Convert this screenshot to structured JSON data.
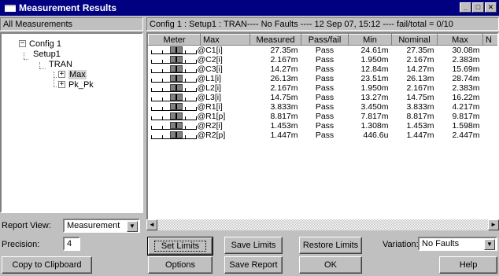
{
  "window": {
    "title": "Measurement Results",
    "controls": {
      "minimize": "_",
      "maximize": "□",
      "close": "✕"
    }
  },
  "left_header": "All Measurements",
  "right_header": "Config 1 : Setup1 : TRAN---- No Faults ----   12 Sep 07, 15:12 ---- fail/total = 0/10",
  "tree": {
    "config": "Config 1",
    "setup": "Setup1",
    "analysis": "TRAN",
    "children": [
      "Max",
      "Pk_Pk"
    ],
    "selected": "Max"
  },
  "table": {
    "columns": [
      "Meter",
      "Max",
      "Measured",
      "Pass/fail",
      "Min",
      "Nominal",
      "Max",
      "N"
    ],
    "rows": [
      {
        "name": "@C1[i]",
        "measured": "27.35m",
        "pass": "Pass",
        "min": "24.61m",
        "nominal": "27.35m",
        "max": "30.08m"
      },
      {
        "name": "@C2[i]",
        "measured": "2.167m",
        "pass": "Pass",
        "min": "1.950m",
        "nominal": "2.167m",
        "max": "2.383m"
      },
      {
        "name": "@C3[i]",
        "measured": "14.27m",
        "pass": "Pass",
        "min": "12.84m",
        "nominal": "14.27m",
        "max": "15.69m"
      },
      {
        "name": "@L1[i]",
        "measured": "26.13m",
        "pass": "Pass",
        "min": "23.51m",
        "nominal": "26.13m",
        "max": "28.74m"
      },
      {
        "name": "@L2[i]",
        "measured": "2.167m",
        "pass": "Pass",
        "min": "1.950m",
        "nominal": "2.167m",
        "max": "2.383m"
      },
      {
        "name": "@L3[i]",
        "measured": "14.75m",
        "pass": "Pass",
        "min": "13.27m",
        "nominal": "14.75m",
        "max": "16.22m"
      },
      {
        "name": "@R1[i]",
        "measured": "3.833m",
        "pass": "Pass",
        "min": "3.450m",
        "nominal": "3.833m",
        "max": "4.217m"
      },
      {
        "name": "@R1[p]",
        "measured": "8.817m",
        "pass": "Pass",
        "min": "7.817m",
        "nominal": "8.817m",
        "max": "9.817m"
      },
      {
        "name": "@R2[i]",
        "measured": "1.453m",
        "pass": "Pass",
        "min": "1.308m",
        "nominal": "1.453m",
        "max": "1.598m"
      },
      {
        "name": "@R2[p]",
        "measured": "1.447m",
        "pass": "Pass",
        "min": "446.6u",
        "nominal": "1.447m",
        "max": "2.447m"
      }
    ]
  },
  "report_view": {
    "label": "Report View:",
    "value": "Measurement"
  },
  "precision": {
    "label": "Precision:",
    "value": "4"
  },
  "variation": {
    "label": "Variation:",
    "value": "No Faults"
  },
  "buttons": {
    "copy": "Copy to Clipboard",
    "set_limits": "Set Limits",
    "save_limits": "Save Limits",
    "restore_limits": "Restore Limits",
    "options": "Options",
    "save_report": "Save Report",
    "ok": "OK",
    "help": "Help"
  },
  "icons": {
    "scroll_left": "◄",
    "scroll_right": "►",
    "dropdown": "▼",
    "collapse": "−",
    "expand": "+"
  }
}
